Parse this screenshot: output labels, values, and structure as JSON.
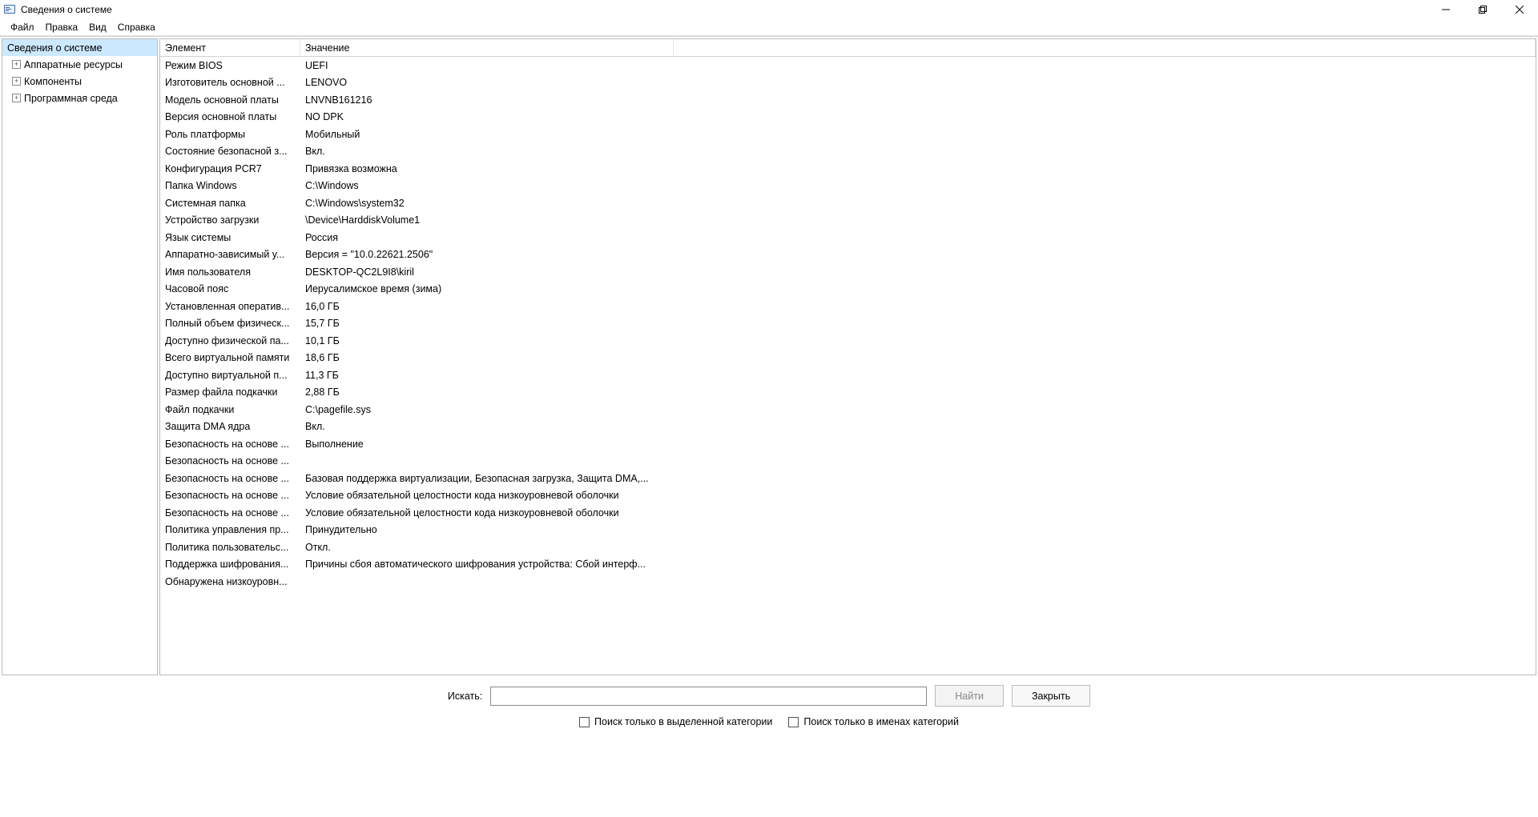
{
  "window": {
    "title": "Сведения о системе"
  },
  "menubar": {
    "file": "Файл",
    "edit": "Правка",
    "view": "Вид",
    "help": "Справка"
  },
  "tree": {
    "root": "Сведения о системе",
    "items": [
      {
        "label": "Аппаратные ресурсы"
      },
      {
        "label": "Компоненты"
      },
      {
        "label": "Программная среда"
      }
    ]
  },
  "list": {
    "headers": {
      "element": "Элемент",
      "value": "Значение"
    },
    "rows": [
      {
        "k": "Режим BIOS",
        "v": "UEFI"
      },
      {
        "k": "Изготовитель основной ...",
        "v": "LENOVO"
      },
      {
        "k": "Модель основной платы",
        "v": "LNVNB161216"
      },
      {
        "k": "Версия основной платы",
        "v": "NO DPK"
      },
      {
        "k": "Роль платформы",
        "v": "Мобильный"
      },
      {
        "k": "Состояние безопасной з...",
        "v": "Вкл."
      },
      {
        "k": "Конфигурация PCR7",
        "v": "Привязка возможна"
      },
      {
        "k": "Папка Windows",
        "v": "C:\\Windows"
      },
      {
        "k": "Системная папка",
        "v": "C:\\Windows\\system32"
      },
      {
        "k": "Устройство загрузки",
        "v": "\\Device\\HarddiskVolume1"
      },
      {
        "k": "Язык системы",
        "v": "Россия"
      },
      {
        "k": "Аппаратно-зависимый у...",
        "v": "Версия = \"10.0.22621.2506\""
      },
      {
        "k": "Имя пользователя",
        "v": "DESKTOP-QC2L9I8\\kiril"
      },
      {
        "k": "Часовой пояс",
        "v": "Иерусалимское время (зима)"
      },
      {
        "k": "Установленная оператив...",
        "v": "16,0 ГБ"
      },
      {
        "k": "Полный объем физическ...",
        "v": "15,7 ГБ"
      },
      {
        "k": "Доступно физической па...",
        "v": "10,1 ГБ"
      },
      {
        "k": "Всего виртуальной памяти",
        "v": "18,6 ГБ"
      },
      {
        "k": "Доступно виртуальной п...",
        "v": "11,3 ГБ"
      },
      {
        "k": "Размер файла подкачки",
        "v": "2,88 ГБ"
      },
      {
        "k": "Файл подкачки",
        "v": "C:\\pagefile.sys"
      },
      {
        "k": "Защита DMA ядра",
        "v": "Вкл."
      },
      {
        "k": "Безопасность на основе ...",
        "v": "Выполнение"
      },
      {
        "k": "Безопасность на основе ...",
        "v": ""
      },
      {
        "k": "Безопасность на основе ...",
        "v": "Базовая поддержка виртуализации, Безопасная загрузка, Защита DMA,..."
      },
      {
        "k": "Безопасность на основе ...",
        "v": "Условие обязательной целостности кода низкоуровневой оболочки"
      },
      {
        "k": "Безопасность на основе ...",
        "v": "Условие обязательной целостности кода низкоуровневой оболочки"
      },
      {
        "k": "Политика управления пр...",
        "v": "Принудительно"
      },
      {
        "k": "Политика пользовательс...",
        "v": "Откл."
      },
      {
        "k": "Поддержка шифрования...",
        "v": "Причины сбоя автоматического шифрования устройства: Сбой интерф..."
      },
      {
        "k": "Обнаружена низкоуровн...",
        "v": ""
      }
    ]
  },
  "search": {
    "label": "Искать:",
    "find": "Найти",
    "close": "Закрыть",
    "only_category": "Поиск только в выделенной категории",
    "only_names": "Поиск только в именах категорий"
  }
}
